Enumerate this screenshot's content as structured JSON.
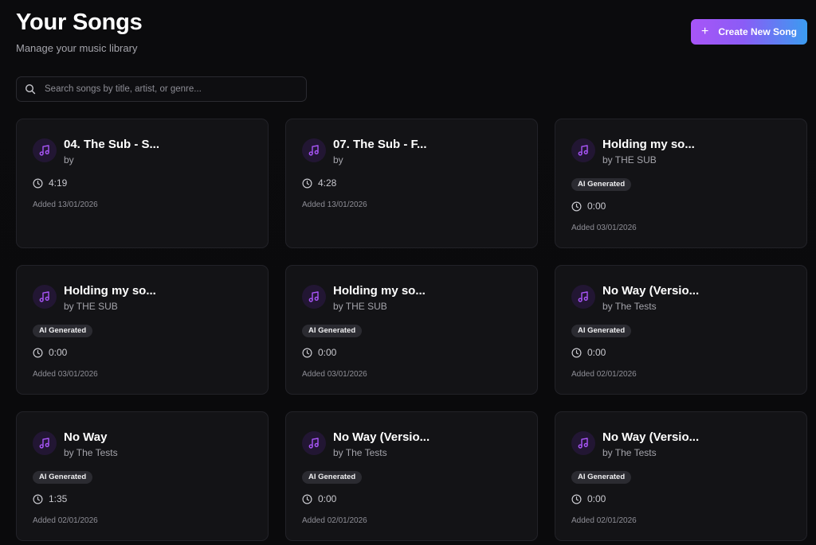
{
  "header": {
    "title": "Your Songs",
    "subtitle": "Manage your music library",
    "create_button_label": "Create New Song",
    "create_button_icon": "plus-icon"
  },
  "search": {
    "placeholder": "Search songs by title, artist, or genre...",
    "value": "",
    "icon": "search-icon"
  },
  "colors": {
    "background": "#0b0b0d",
    "card": "#131316",
    "accent_purple": "#a855f7",
    "accent_blue": "#3b9cf0",
    "icon_bg": "#221633"
  },
  "songs": [
    {
      "title": "04. The Sub - S...",
      "artist": "by",
      "badge": "",
      "duration": "4:19",
      "added": "Added 13/01/2026",
      "icon": "music-note-icon"
    },
    {
      "title": "07. The Sub - F...",
      "artist": "by",
      "badge": "",
      "duration": "4:28",
      "added": "Added 13/01/2026",
      "icon": "music-note-icon"
    },
    {
      "title": "Holding my so...",
      "artist": "by THE SUB",
      "badge": "AI Generated",
      "duration": "0:00",
      "added": "Added 03/01/2026",
      "icon": "music-note-icon"
    },
    {
      "title": "Holding my so...",
      "artist": "by THE SUB",
      "badge": "AI Generated",
      "duration": "0:00",
      "added": "Added 03/01/2026",
      "icon": "music-note-icon"
    },
    {
      "title": "Holding my so...",
      "artist": "by THE SUB",
      "badge": "AI Generated",
      "duration": "0:00",
      "added": "Added 03/01/2026",
      "icon": "music-note-icon"
    },
    {
      "title": "No Way (Versio...",
      "artist": "by The Tests",
      "badge": "AI Generated",
      "duration": "0:00",
      "added": "Added 02/01/2026",
      "icon": "music-note-icon"
    },
    {
      "title": "No Way",
      "artist": "by The Tests",
      "badge": "AI Generated",
      "duration": "1:35",
      "added": "Added 02/01/2026",
      "icon": "music-note-icon"
    },
    {
      "title": "No Way (Versio...",
      "artist": "by The Tests",
      "badge": "AI Generated",
      "duration": "0:00",
      "added": "Added 02/01/2026",
      "icon": "music-note-icon"
    },
    {
      "title": "No Way (Versio...",
      "artist": "by The Tests",
      "badge": "AI Generated",
      "duration": "0:00",
      "added": "Added 02/01/2026",
      "icon": "music-note-icon"
    }
  ]
}
